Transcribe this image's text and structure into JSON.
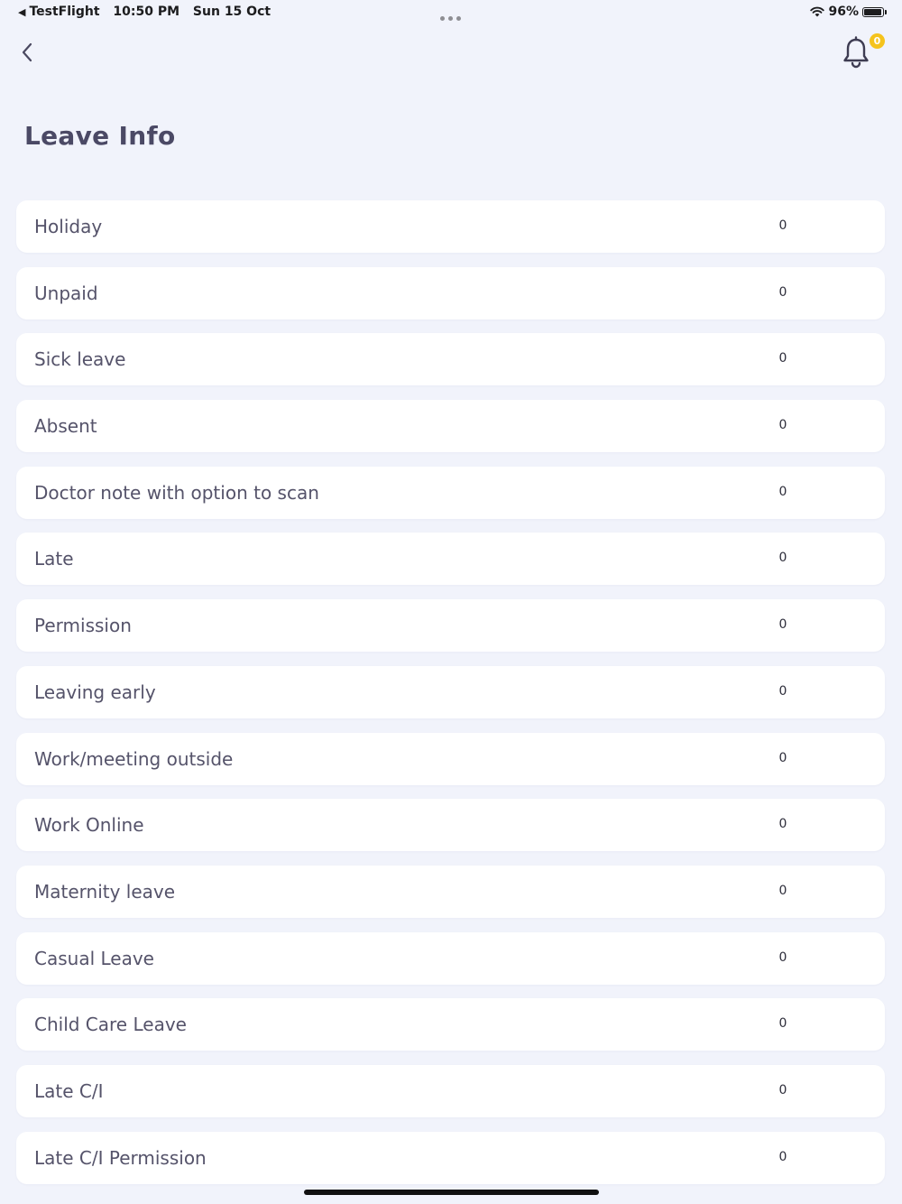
{
  "status_bar": {
    "back_app": "TestFlight",
    "time": "10:50 PM",
    "date": "Sun 15 Oct",
    "battery": "96%",
    "battery_level": 0.96,
    "icons": [
      "back-triangle-icon",
      "wifi-icon",
      "battery-icon"
    ]
  },
  "header": {
    "back_icon": "chevron-left-icon",
    "bell_icon": "bell-icon",
    "notification_count": "0"
  },
  "page": {
    "title": "Leave Info"
  },
  "leave_items": [
    {
      "label": "Holiday",
      "count": "0"
    },
    {
      "label": "Unpaid",
      "count": "0"
    },
    {
      "label": "Sick leave",
      "count": "0"
    },
    {
      "label": "Absent",
      "count": "0"
    },
    {
      "label": "Doctor note with option to scan",
      "count": "0"
    },
    {
      "label": "Late",
      "count": "0"
    },
    {
      "label": "Permission",
      "count": "0"
    },
    {
      "label": "Leaving early",
      "count": "0"
    },
    {
      "label": "Work/meeting outside",
      "count": "0"
    },
    {
      "label": "Work Online",
      "count": "0"
    },
    {
      "label": "Maternity leave",
      "count": "0"
    },
    {
      "label": "Casual Leave",
      "count": "0"
    },
    {
      "label": "Child Care Leave",
      "count": "0"
    },
    {
      "label": "Late C/I",
      "count": "0"
    },
    {
      "label": "Late C/I Permission",
      "count": "0"
    }
  ],
  "colors": {
    "background": "#f1f3fb",
    "card": "#ffffff",
    "title": "#4b4965",
    "label": "#55536a",
    "badge": "#f5c31c"
  }
}
